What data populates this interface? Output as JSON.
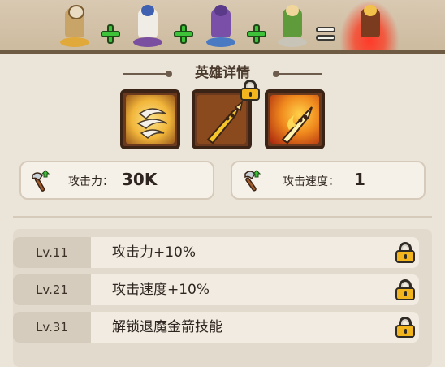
{
  "merge_bar": {
    "heroes": [
      {
        "name_icon": "golden-hood-hero-icon",
        "color": "#d9a43a"
      },
      {
        "name_icon": "bearded-wizard-hero-icon",
        "color": "#3f5fb0"
      },
      {
        "name_icon": "hooded-archer-hero-icon",
        "color": "#7a4fa8"
      },
      {
        "name_icon": "elf-archer-hero-icon",
        "color": "#5f9a3b"
      }
    ],
    "result": {
      "name_icon": "golden-archer-hero-icon",
      "glow_color": "#ff3a2a"
    }
  },
  "section_title": "英雄详情",
  "skills": [
    {
      "icon": "wind-slash-skill-icon",
      "locked": false
    },
    {
      "icon": "golden-arrow-skill-icon",
      "locked": true
    },
    {
      "icon": "flaming-arrow-skill-icon",
      "locked": false
    }
  ],
  "stats": {
    "attack": {
      "icon": "axe-upgrade-icon",
      "label": "攻击力：",
      "value": "30K"
    },
    "attack_speed": {
      "icon": "axe-speed-upgrade-icon",
      "label": "攻击速度：",
      "value": "1"
    }
  },
  "levels": [
    {
      "level": "Lv.11",
      "desc": "攻击力+10%",
      "locked": true
    },
    {
      "level": "Lv.21",
      "desc": "攻击速度+10%",
      "locked": true
    },
    {
      "level": "Lv.31",
      "desc": "解锁退魔金箭技能",
      "locked": true
    }
  ],
  "colors": {
    "background": "#ebe4d8",
    "plus_green": "#3dc23a",
    "lock_gold": "#f3b51d",
    "skill_frame": "#3b2416"
  }
}
